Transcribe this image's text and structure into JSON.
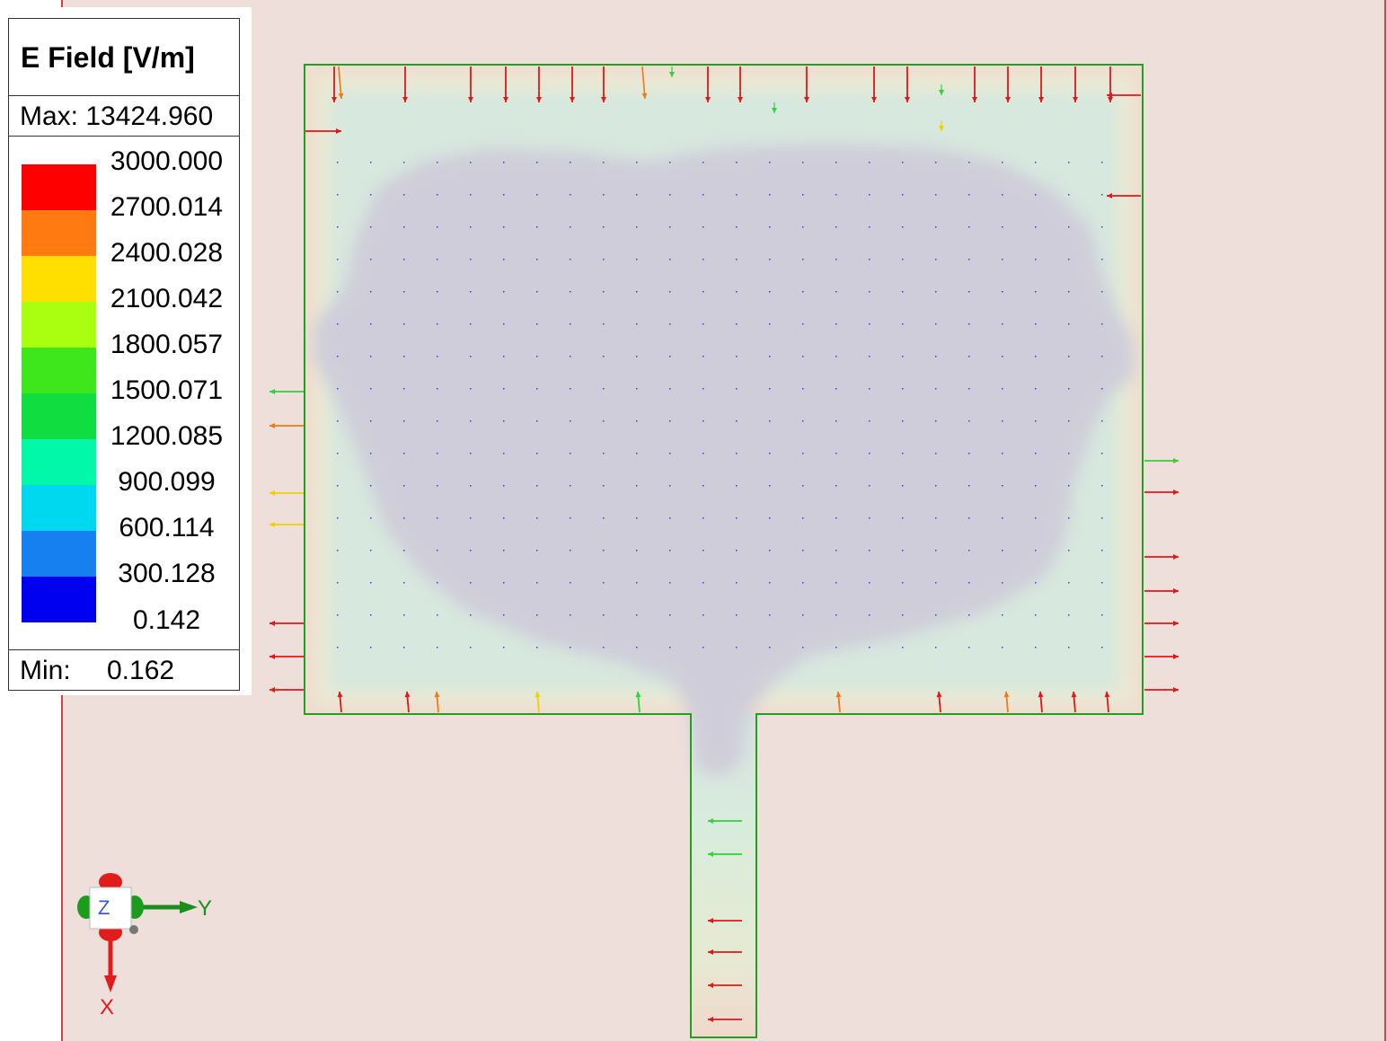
{
  "legend": {
    "title": "E Field [V/m]",
    "max_label": "Max: 13424.960",
    "min_label": "Min:",
    "min_value": "0.162",
    "bands": [
      {
        "label": "3000.000",
        "color": "#ff0000"
      },
      {
        "label": "2700.014",
        "color": "#ff7a10"
      },
      {
        "label": "2400.028",
        "color": "#ffdf00"
      },
      {
        "label": "2100.042",
        "color": "#aaff10"
      },
      {
        "label": "1800.057",
        "color": "#3ee61c"
      },
      {
        "label": "1500.071",
        "color": "#10dd40"
      },
      {
        "label": "1200.085",
        "color": "#00f8a8"
      },
      {
        "label": "900.099",
        "color": "#00d8f0"
      },
      {
        "label": "600.114",
        "color": "#1680f0"
      },
      {
        "label": "300.128",
        "color": "#0000f0"
      },
      {
        "label": "0.142",
        "color": ""
      }
    ]
  },
  "axes": {
    "x_label": "X",
    "y_label": "Y",
    "z_label": "Z"
  },
  "colors": {
    "background": "#eedfdb",
    "outline": "#1ea21e",
    "low_field": "#cfcdd9",
    "boundary_line": "#d01010"
  }
}
